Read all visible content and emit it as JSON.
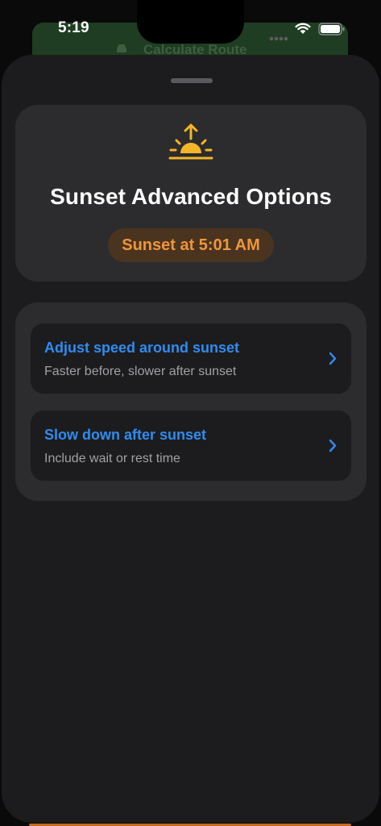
{
  "status_bar": {
    "time": "5:19"
  },
  "background_app": {
    "button_label": "Calculate Route"
  },
  "header": {
    "icon": "sunset-icon",
    "title": "Sunset Advanced Options",
    "sunset_badge": "Sunset at 5:01 AM"
  },
  "options": [
    {
      "title": "Adjust speed around sunset",
      "subtitle": "Faster before, slower after sunset",
      "icon": "chevron-right-icon"
    },
    {
      "title": "Slow down after sunset",
      "subtitle": "Include wait or rest time",
      "icon": "chevron-right-icon"
    }
  ],
  "colors": {
    "sheet_background": "#1c1c1e",
    "card_background": "#2c2c2e",
    "accent_blue": "#2f8cf0",
    "sunset_orange": "#f0953a",
    "icon_yellow": "#f5b528"
  }
}
